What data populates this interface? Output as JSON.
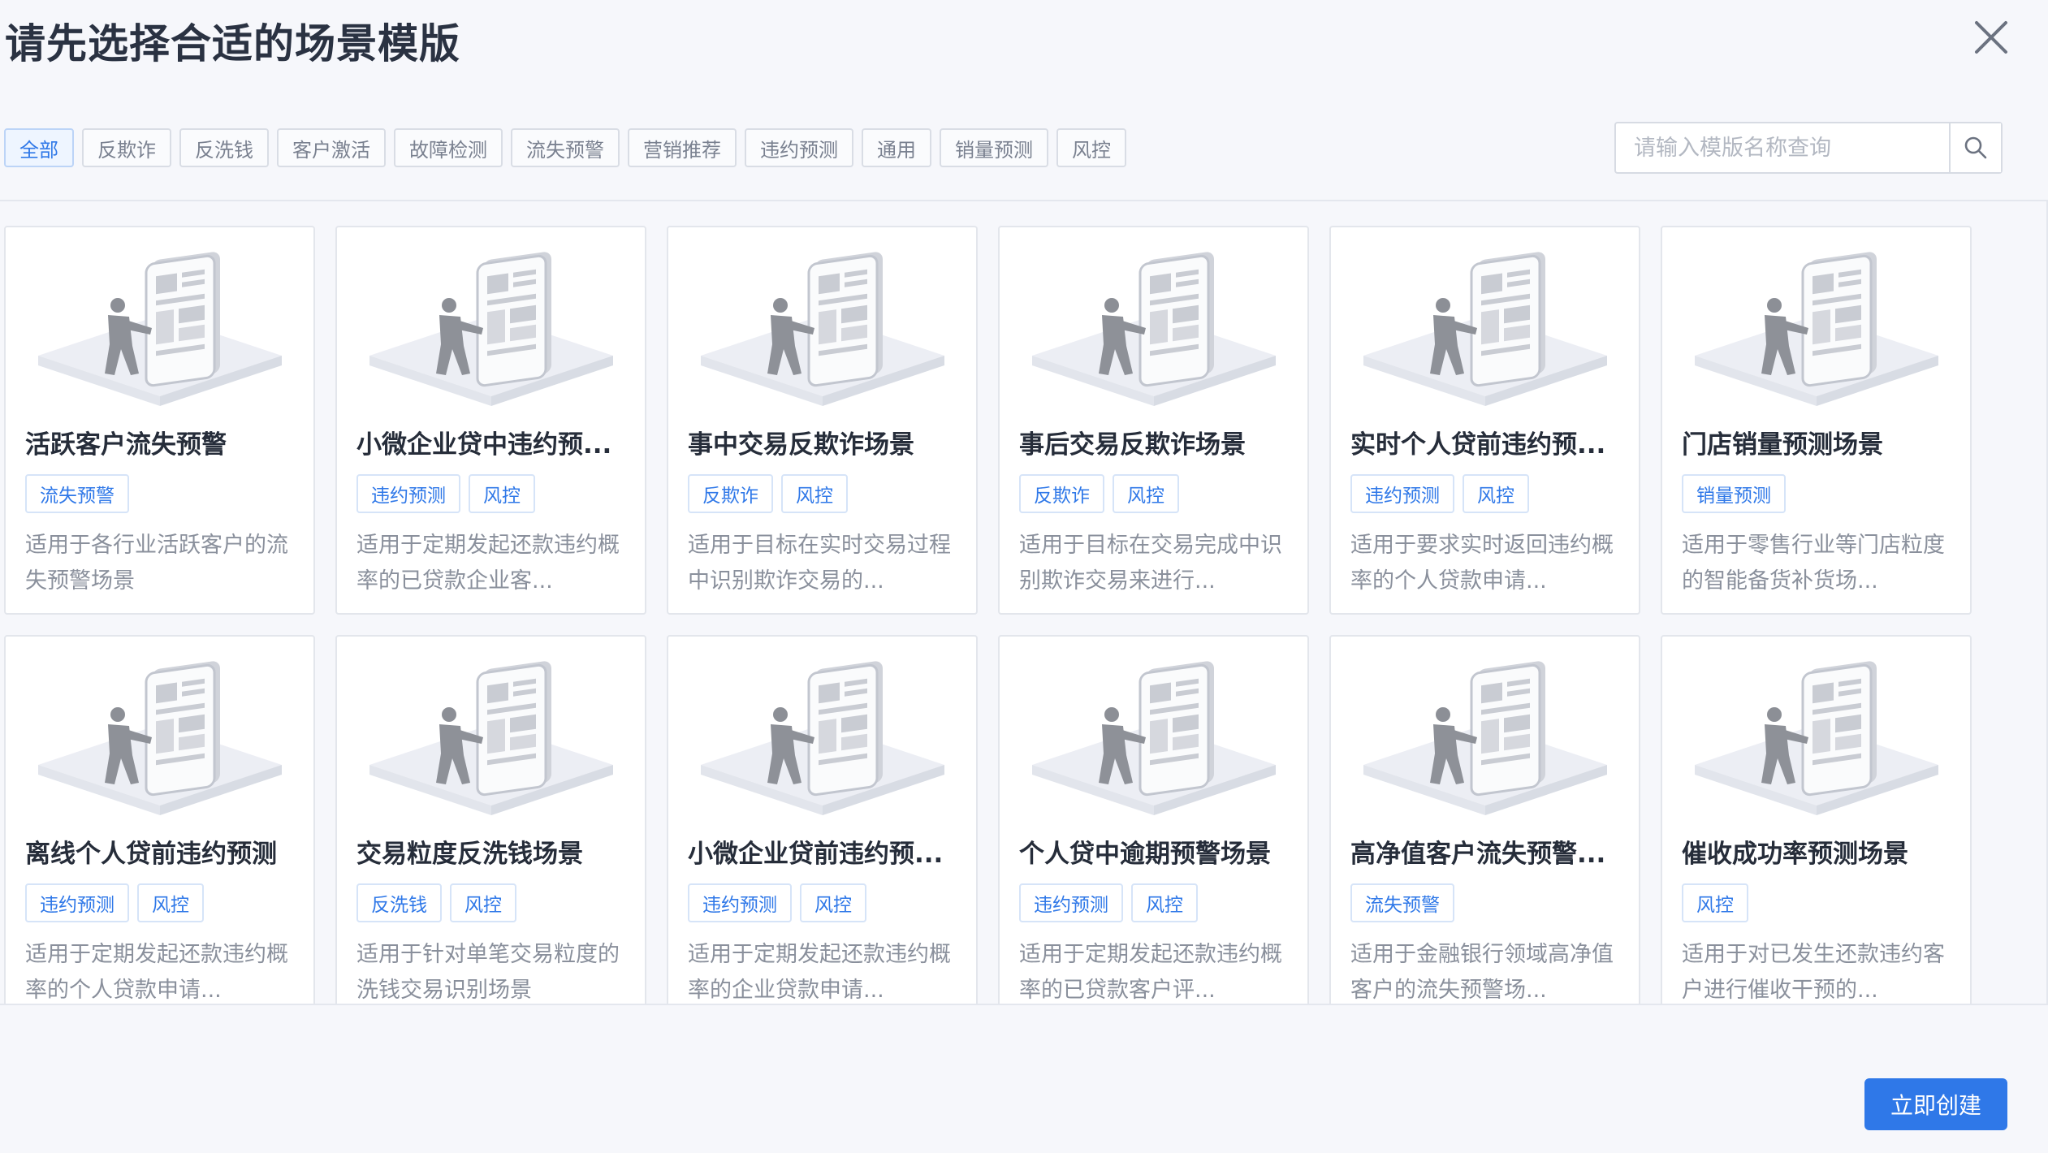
{
  "dialog": {
    "title": "请先选择合适的场景模版",
    "close_icon": "close-icon"
  },
  "filters": [
    {
      "label": "全部",
      "active": true
    },
    {
      "label": "反欺诈",
      "active": false
    },
    {
      "label": "反洗钱",
      "active": false
    },
    {
      "label": "客户激活",
      "active": false
    },
    {
      "label": "故障检测",
      "active": false
    },
    {
      "label": "流失预警",
      "active": false
    },
    {
      "label": "营销推荐",
      "active": false
    },
    {
      "label": "违约预测",
      "active": false
    },
    {
      "label": "通用",
      "active": false
    },
    {
      "label": "销量预测",
      "active": false
    },
    {
      "label": "风控",
      "active": false
    }
  ],
  "search": {
    "placeholder": "请输入模版名称查询",
    "value": "",
    "icon": "search-icon"
  },
  "templates": [
    {
      "title": "活跃客户流失预警",
      "tags": [
        "流失预警"
      ],
      "desc": "适用于各行业活跃客户的流失预警场景"
    },
    {
      "title": "小微企业贷中违约预...",
      "tags": [
        "违约预测",
        "风控"
      ],
      "desc": "适用于定期发起还款违约概率的已贷款企业客..."
    },
    {
      "title": "事中交易反欺诈场景",
      "tags": [
        "反欺诈",
        "风控"
      ],
      "desc": "适用于目标在实时交易过程中识别欺诈交易的..."
    },
    {
      "title": "事后交易反欺诈场景",
      "tags": [
        "反欺诈",
        "风控"
      ],
      "desc": "适用于目标在交易完成中识别欺诈交易来进行..."
    },
    {
      "title": "实时个人贷前违约预...",
      "tags": [
        "违约预测",
        "风控"
      ],
      "desc": "适用于要求实时返回违约概率的个人贷款申请..."
    },
    {
      "title": "门店销量预测场景",
      "tags": [
        "销量预测"
      ],
      "desc": "适用于零售行业等门店粒度的智能备货补货场..."
    },
    {
      "title": "离线个人贷前违约预测",
      "tags": [
        "违约预测",
        "风控"
      ],
      "desc": "适用于定期发起还款违约概率的个人贷款申请..."
    },
    {
      "title": "交易粒度反洗钱场景",
      "tags": [
        "反洗钱",
        "风控"
      ],
      "desc": "适用于针对单笔交易粒度的洗钱交易识别场景"
    },
    {
      "title": "小微企业贷前违约预...",
      "tags": [
        "违约预测",
        "风控"
      ],
      "desc": "适用于定期发起还款违约概率的企业贷款申请..."
    },
    {
      "title": "个人贷中逾期预警场景",
      "tags": [
        "违约预测",
        "风控"
      ],
      "desc": "适用于定期发起还款违约概率的已贷款客户评..."
    },
    {
      "title": "高净值客户流失预警...",
      "tags": [
        "流失预警"
      ],
      "desc": "适用于金融银行领域高净值客户的流失预警场..."
    },
    {
      "title": "催收成功率预测场景",
      "tags": [
        "风控"
      ],
      "desc": "适用于对已发生还款违约客户进行催收干预的..."
    }
  ],
  "footer": {
    "create_label": "立即创建"
  },
  "colors": {
    "accent": "#2f78e8",
    "background": "#f6f7fb"
  }
}
